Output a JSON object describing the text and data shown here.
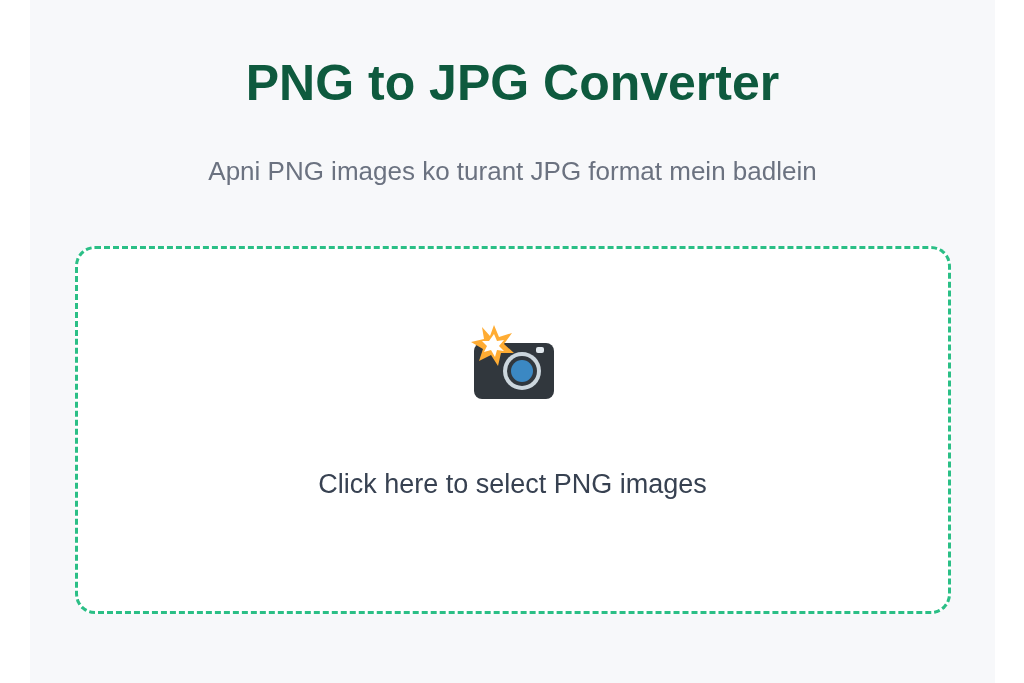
{
  "title": "PNG to JPG Converter",
  "subtitle": "Apni PNG images ko turant JPG format mein badlein",
  "upload_area": {
    "label": "Click here to select PNG images"
  }
}
